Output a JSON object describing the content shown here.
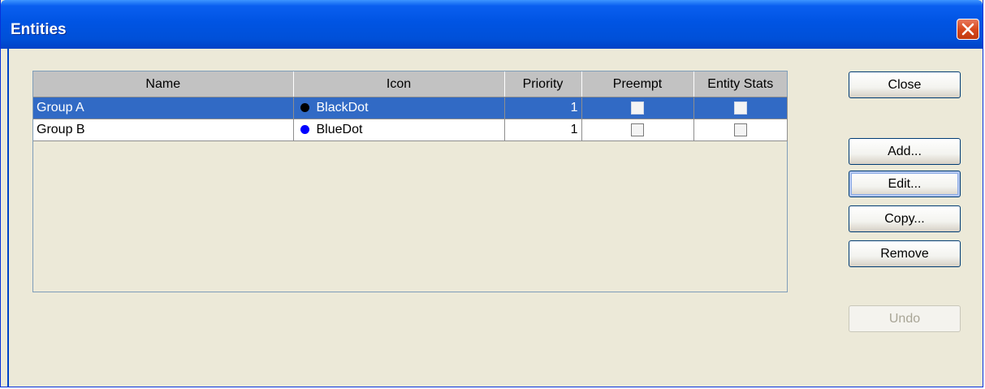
{
  "window": {
    "title": "Entities"
  },
  "table": {
    "columns": [
      "Name",
      "Icon",
      "Priority",
      "Preempt",
      "Entity Stats"
    ],
    "rows": [
      {
        "name": "Group A",
        "icon_color": "#000000",
        "icon": "BlackDot",
        "priority": "1",
        "preempt": false,
        "entity_stats": false,
        "selected": true
      },
      {
        "name": "Group B",
        "icon_color": "#0000ff",
        "icon": "BlueDot",
        "priority": "1",
        "preempt": false,
        "entity_stats": false,
        "selected": false
      }
    ]
  },
  "buttons": {
    "close": "Close",
    "add": "Add...",
    "edit": "Edit...",
    "copy": "Copy...",
    "remove": "Remove",
    "undo": "Undo"
  },
  "colors": {
    "titlebar": "#0054e3",
    "selection": "#316ac5",
    "header": "#c2c2c2"
  }
}
